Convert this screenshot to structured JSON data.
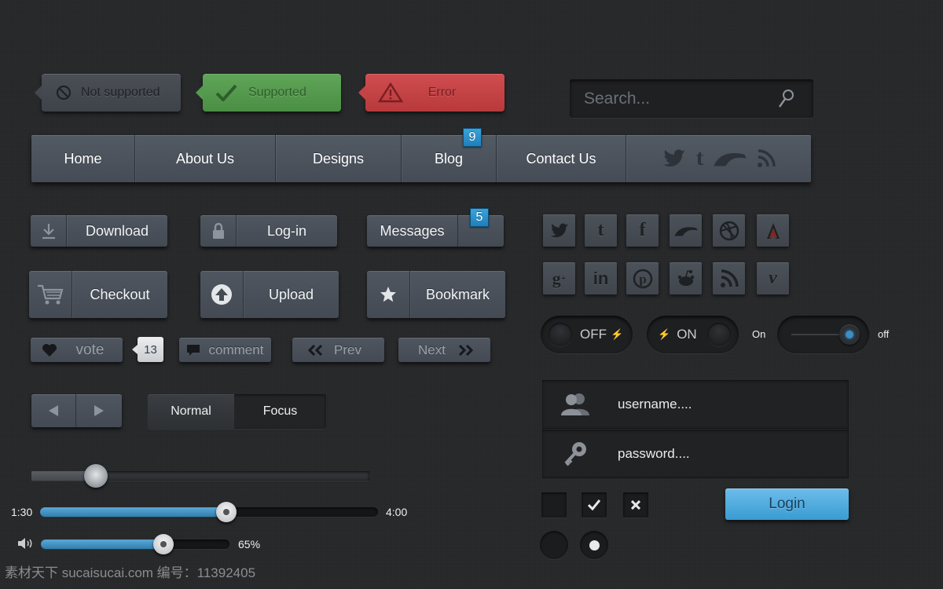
{
  "notices": {
    "not_supported": "Not supported",
    "supported": "Supported",
    "error": "Error"
  },
  "search": {
    "placeholder": "Search..."
  },
  "nav": {
    "items": [
      "Home",
      "About Us",
      "Designs",
      "Blog",
      "Contact Us"
    ],
    "blog_badge": "9",
    "social_icons": [
      "twitter-icon",
      "tumblr-icon",
      "deviantart-icon",
      "rss-icon"
    ]
  },
  "buttons": {
    "download": "Download",
    "login": "Log-in",
    "messages": "Messages",
    "messages_badge": "5",
    "checkout": "Checkout",
    "upload": "Upload",
    "bookmark": "Bookmark",
    "vote": "vote",
    "vote_count": "13",
    "comment": "comment",
    "prev": "Prev",
    "next": "Next"
  },
  "segmented": {
    "normal": "Normal",
    "focus": "Focus"
  },
  "social_grid": {
    "row1": [
      "twitter-icon",
      "tumblr-icon",
      "facebook-icon",
      "deviantart-icon",
      "dribbble-icon",
      "stumbleupon-icon"
    ],
    "row2": [
      "googleplus-icon",
      "linkedin-icon",
      "pinterest-icon",
      "reddit-icon",
      "rss-icon",
      "vimeo-icon"
    ]
  },
  "toggles": {
    "off_label": "OFF",
    "on_label": "ON",
    "switch_on": "On",
    "switch_off": "off"
  },
  "form": {
    "username_placeholder": "username....",
    "password_placeholder": "password....",
    "login": "Login"
  },
  "media": {
    "current_time": "1:30",
    "total_time": "4:00",
    "progress": 0.55,
    "volume_label": "65%",
    "volume": 0.65,
    "top_slider": 0.19
  },
  "watermark": {
    "text": "素材天下 sucaisucai.com  编号：11392405"
  },
  "colors": {
    "background": "#262729",
    "accent_blue": "#2f8fc8",
    "success_green": "#559b4e",
    "error_red": "#c44346"
  }
}
